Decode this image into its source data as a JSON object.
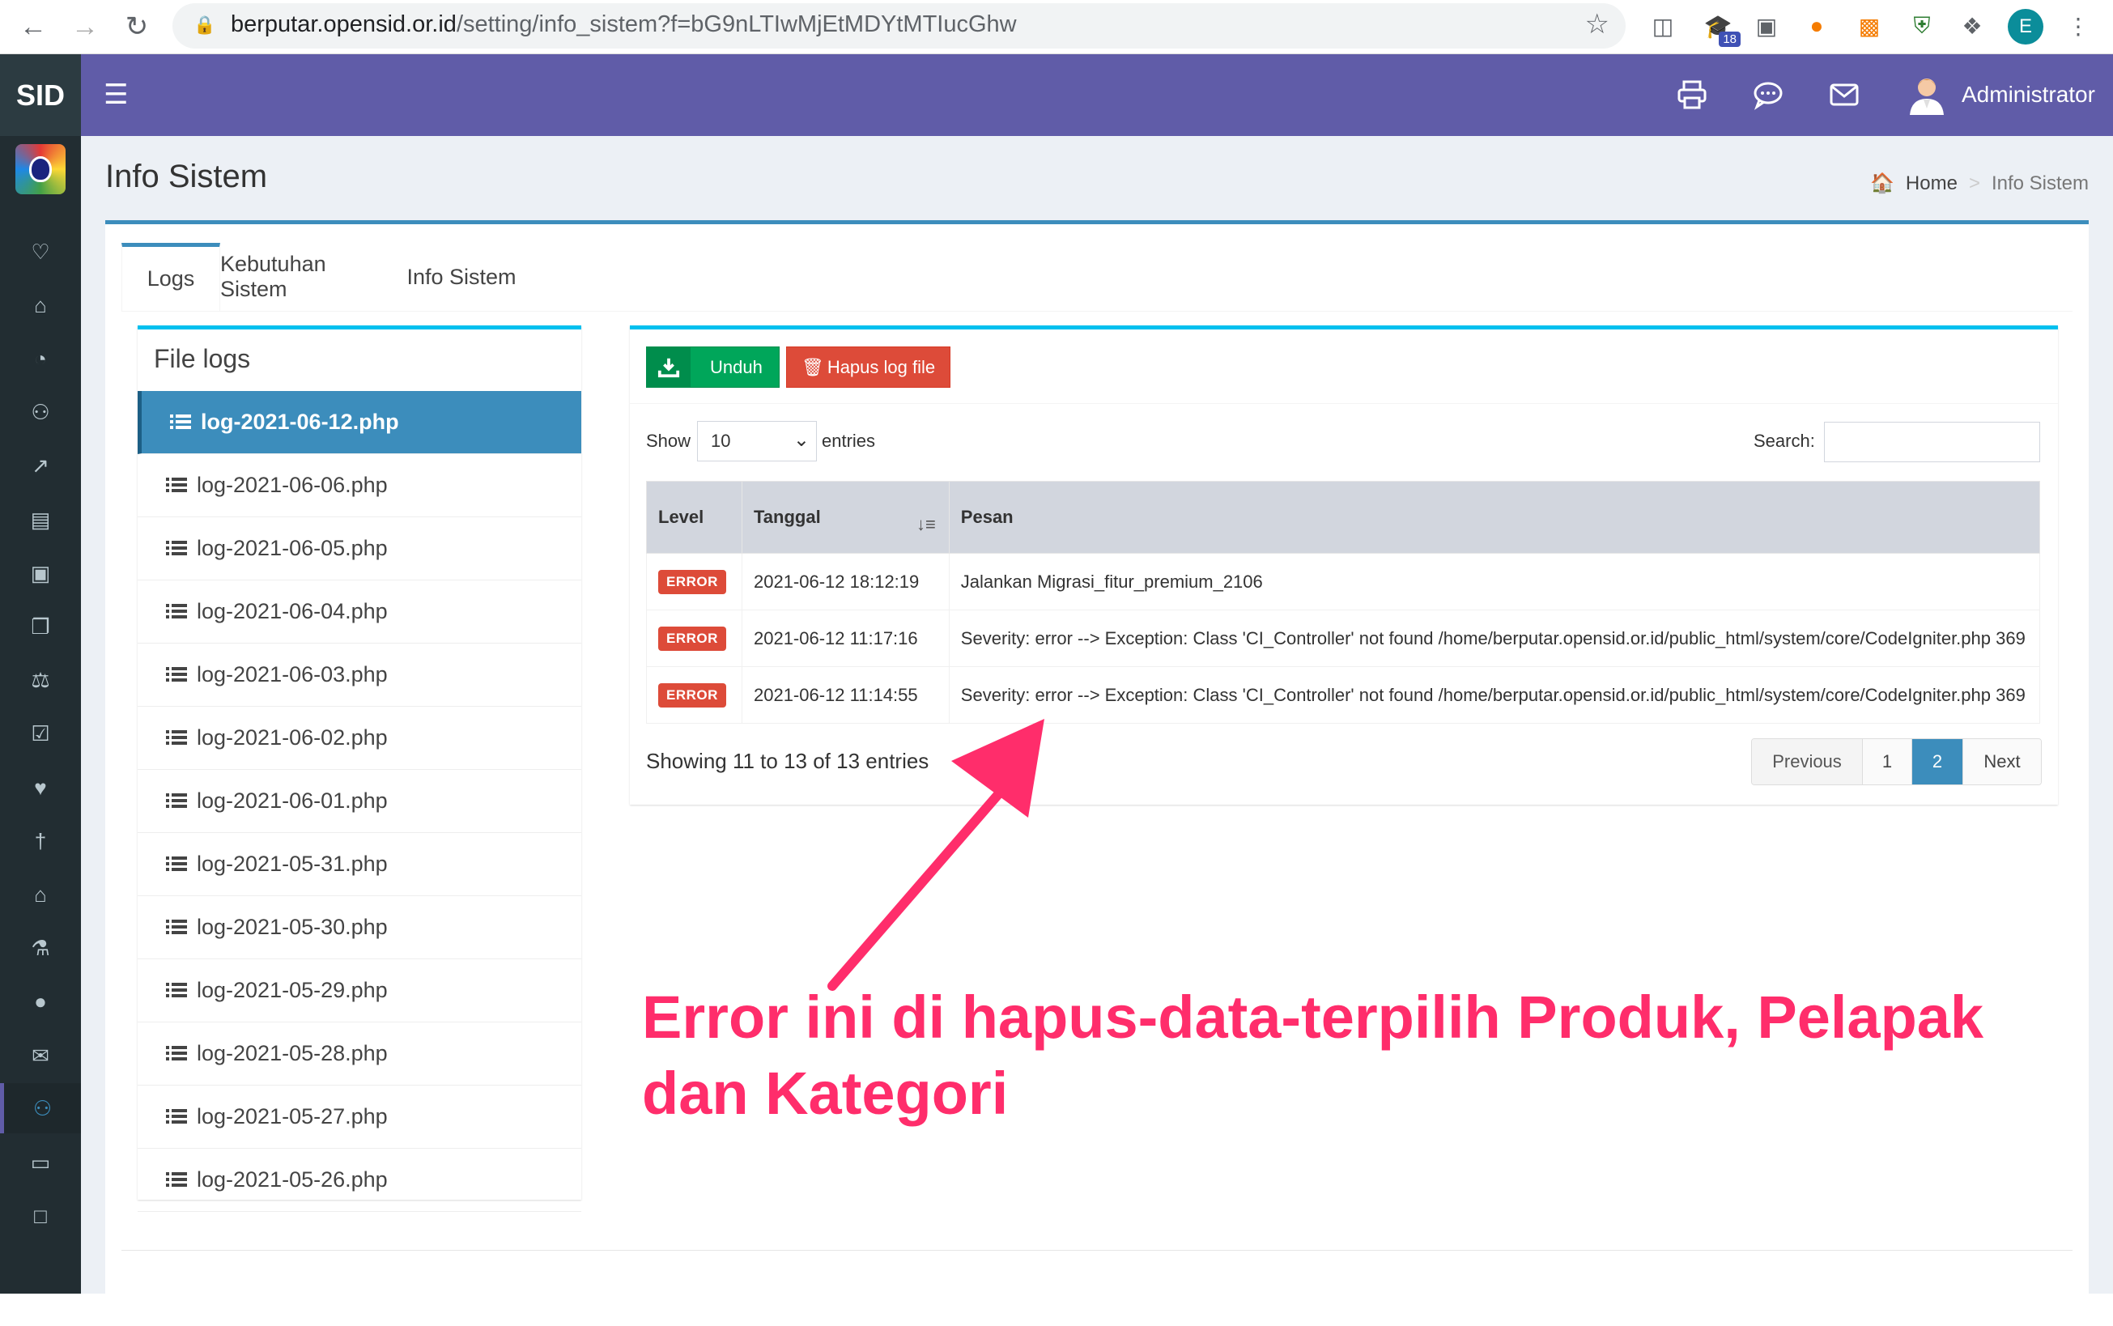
{
  "browser": {
    "url_host": "berputar.opensid.or.id",
    "url_path": "/setting/info_sistem?f=bG9nLTIwMjEtMDYtMTIucGhw",
    "ext_badge": "18",
    "profile_initial": "E"
  },
  "app": {
    "logo_text": "SID",
    "admin_name": "Administrator"
  },
  "page": {
    "title": "Info Sistem",
    "breadcrumb_home": "Home",
    "breadcrumb_sep": ">",
    "breadcrumb_current": "Info Sistem"
  },
  "tabs": [
    {
      "label": "Logs"
    },
    {
      "label": "Kebutuhan Sistem"
    },
    {
      "label": "Info Sistem"
    }
  ],
  "file_logs": {
    "title": "File logs",
    "items": [
      "log-2021-06-12.php",
      "log-2021-06-06.php",
      "log-2021-06-05.php",
      "log-2021-06-04.php",
      "log-2021-06-03.php",
      "log-2021-06-02.php",
      "log-2021-06-01.php",
      "log-2021-05-31.php",
      "log-2021-05-30.php",
      "log-2021-05-29.php",
      "log-2021-05-28.php",
      "log-2021-05-27.php",
      "log-2021-05-26.php"
    ]
  },
  "toolbar": {
    "download_label": "Unduh",
    "delete_label": "Hapus log file"
  },
  "datatable": {
    "show_label": "Show",
    "show_value": "10",
    "entries_label": "entries",
    "search_label": "Search:",
    "columns": [
      "Level",
      "Tanggal",
      "Pesan"
    ],
    "rows": [
      {
        "level": "ERROR",
        "date": "2021-06-12 18:12:19",
        "message": "Jalankan Migrasi_fitur_premium_2106"
      },
      {
        "level": "ERROR",
        "date": "2021-06-12 11:17:16",
        "message": "Severity: error --> Exception: Class 'CI_Controller' not found /home/berputar.opensid.or.id/public_html/system/core/CodeIgniter.php 369"
      },
      {
        "level": "ERROR",
        "date": "2021-06-12 11:14:55",
        "message": "Severity: error --> Exception: Class 'CI_Controller' not found /home/berputar.opensid.or.id/public_html/system/core/CodeIgniter.php 369"
      }
    ],
    "info": "Showing 11 to 13 of 13 entries",
    "pager": {
      "previous": "Previous",
      "page1": "1",
      "page2": "2",
      "next": "Next"
    }
  },
  "annotation": {
    "text": "Error ini di hapus-data-terpilih Produk, Pelapak dan Kategori",
    "color": "#ff2d6b"
  },
  "colors": {
    "topbar": "#605ca8",
    "sidebar": "#222d32",
    "primary": "#3c8dbc",
    "success": "#00a65a",
    "danger": "#dd4b39",
    "info": "#00c0ef"
  },
  "sidebar_icons": [
    "heartbeat-icon",
    "home-icon",
    "dashboard-icon",
    "users-icon",
    "chart-icon",
    "book-icon",
    "archive-icon",
    "files-icon",
    "balance-icon",
    "checkbox-icon",
    "heart-icon",
    "signpost-icon",
    "bank-icon",
    "cart-icon",
    "globe-icon",
    "envelope-icon",
    "users-active-icon",
    "desktop-icon",
    "inbox-icon"
  ]
}
